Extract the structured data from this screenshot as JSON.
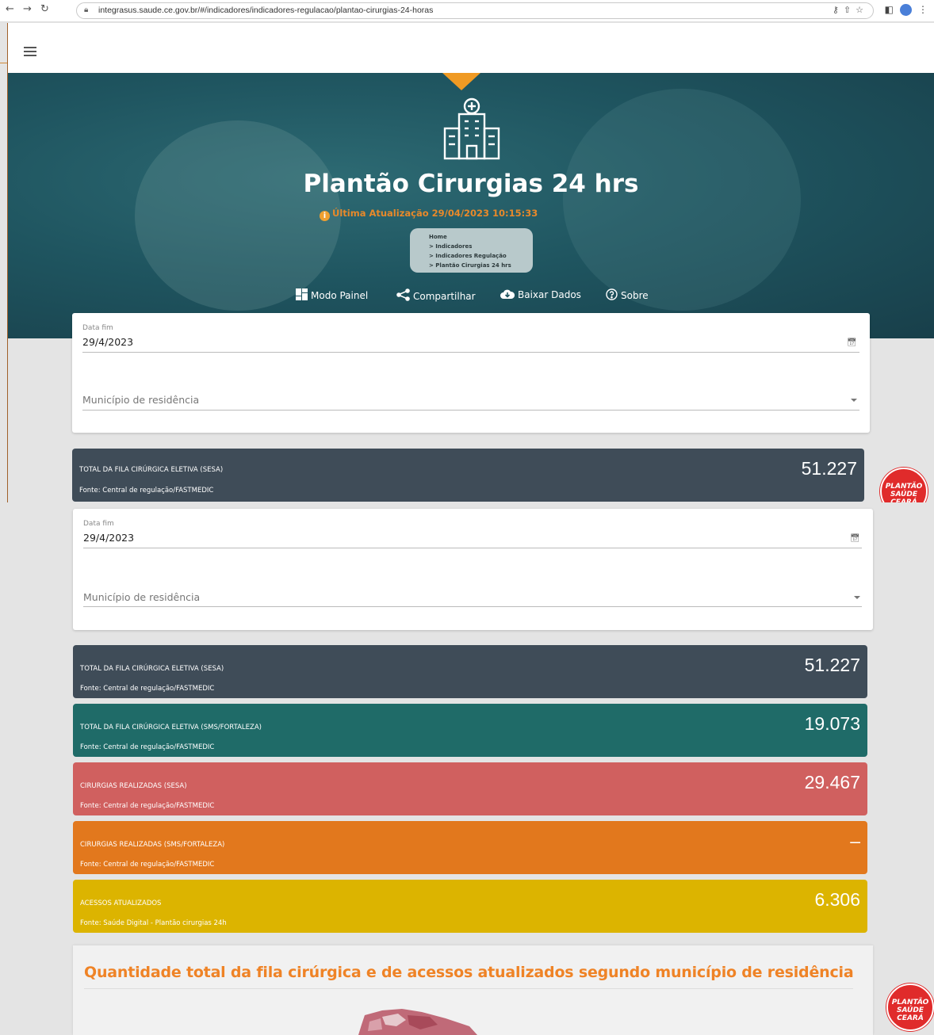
{
  "browser": {
    "url": "integrasus.saude.ce.gov.br/#/indicadores/indicadores-regulacao/plantao-cirurgias-24-horas"
  },
  "hero": {
    "title": "Plantão Cirurgias 24 hrs",
    "update": "Última Atualização 29/04/2023 10:15:33",
    "breadcrumb": [
      "Home",
      "> Indicadores",
      "> Indicadores Regulação",
      "> Plantão Cirurgias 24 hrs"
    ],
    "actions": {
      "panel": "Modo Painel",
      "share": "Compartilhar",
      "download": "Baixar Dados",
      "about": "Sobre"
    }
  },
  "filters": {
    "date_label": "Data fim",
    "date_value": "29/4/2023",
    "municipio_label": "Município de residência"
  },
  "stats": [
    {
      "label": "TOTAL DA FILA CIRÚRGICA ELETIVA (SESA)",
      "source": "Fonte: Central de regulação/FASTMEDIC",
      "value": "51.227",
      "color": "#3f4c58"
    },
    {
      "label": "TOTAL DA FILA CIRÚRGICA ELETIVA (SMS/FORTALEZA)",
      "source": "Fonte: Central de regulação/FASTMEDIC",
      "value": "19.073",
      "color": "#1f6b68"
    },
    {
      "label": "CIRURGIAS REALIZADAS (SESA)",
      "source": "Fonte: Central de regulação/FASTMEDIC",
      "value": "29.467",
      "color": "#d0605f"
    },
    {
      "label": "CIRURGIAS REALIZADAS (SMS/FORTALEZA)",
      "source": "Fonte: Central de regulação/FASTMEDIC",
      "value": "–",
      "color": "#e2781d"
    },
    {
      "label": "ACESSOS ATUALIZADOS",
      "source": "Fonte: Saúde Digital - Plantão cirurgias 24h",
      "value": "6.306",
      "color": "#dcb400"
    }
  ],
  "badge": {
    "line1": "PLANTÃO",
    "line2": "SAÚDE",
    "line3": "CEARÁ"
  },
  "map_section": {
    "title": "Quantidade total da fila cirúrgica e de acessos atualizados segundo município de residência"
  }
}
